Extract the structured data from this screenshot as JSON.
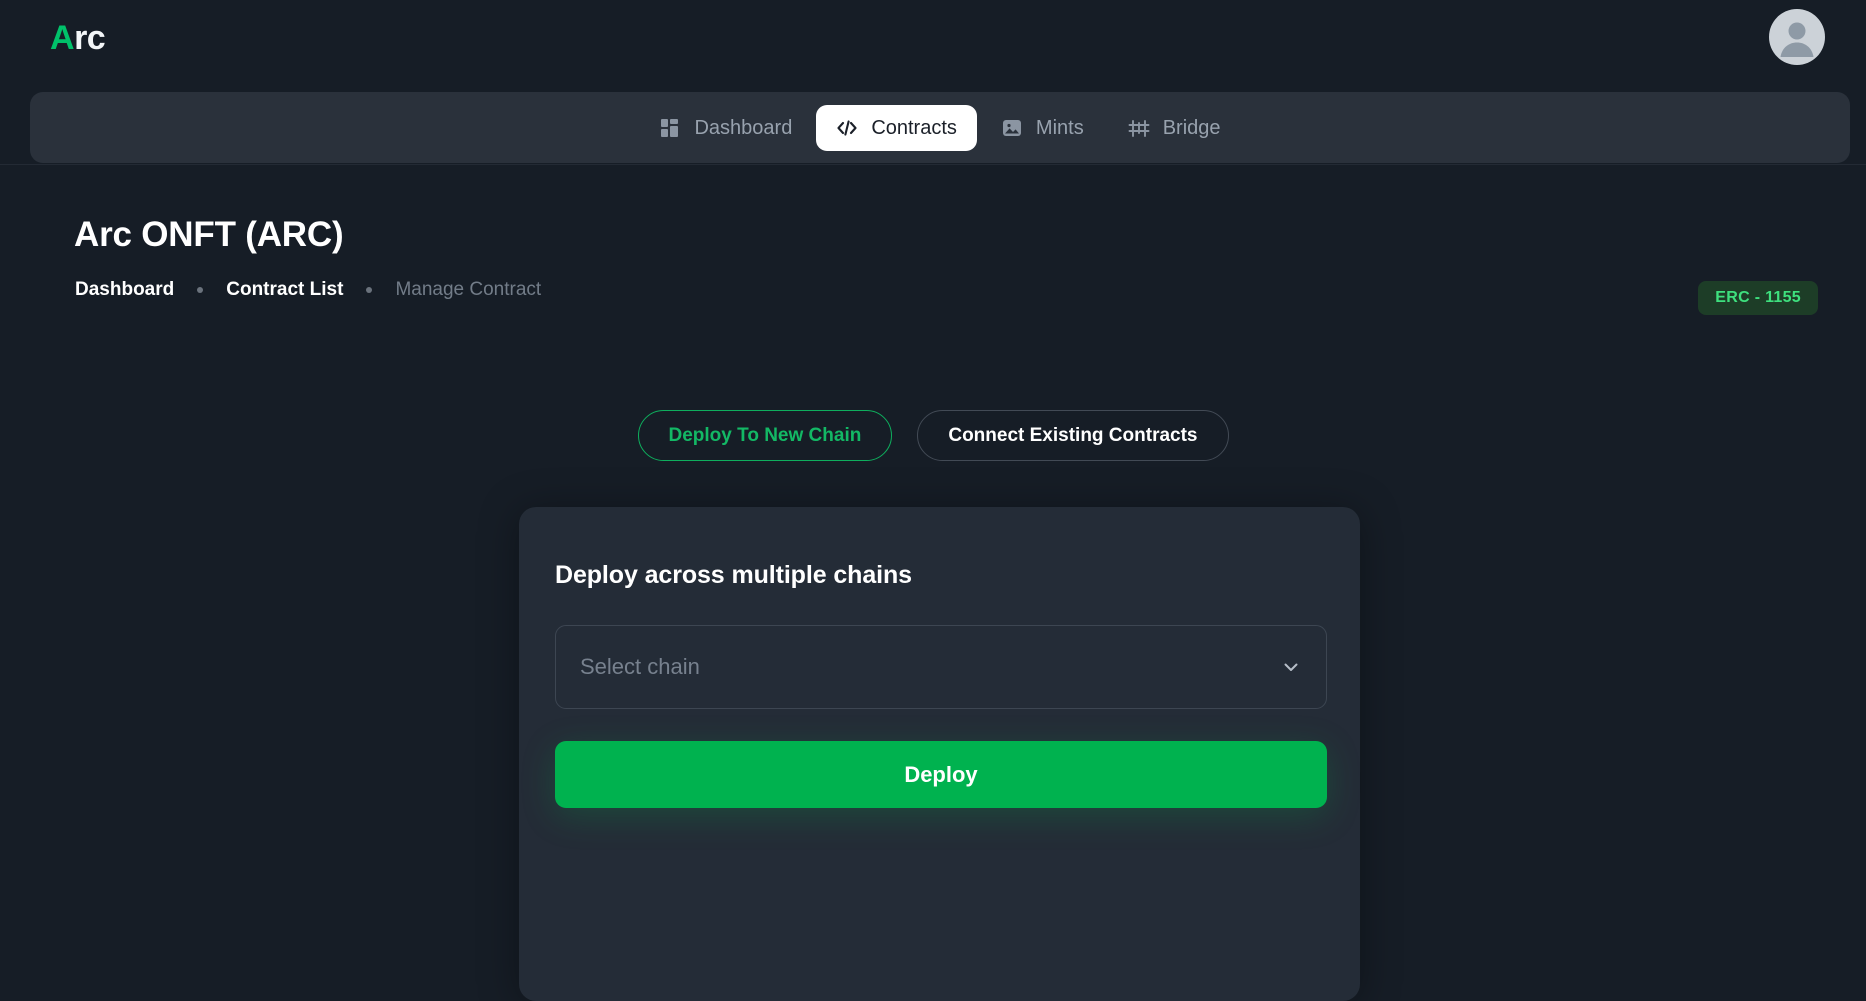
{
  "brand": {
    "accent_letter": "A",
    "rest": "rc",
    "accent_color": "#00c16a"
  },
  "account": {
    "avatar_icon": "user-avatar-icon"
  },
  "nav": {
    "items": [
      {
        "label": "Dashboard",
        "icon": "grid-dashboard-icon",
        "active": false
      },
      {
        "label": "Contracts",
        "icon": "code-brackets-icon",
        "active": true
      },
      {
        "label": "Mints",
        "icon": "image-picture-icon",
        "active": false
      },
      {
        "label": "Bridge",
        "icon": "bridge-icon",
        "active": false
      }
    ]
  },
  "header": {
    "title": "Arc ONFT (ARC)",
    "breadcrumb": [
      {
        "label": "Dashboard",
        "muted": false
      },
      {
        "label": "Contract List",
        "muted": false
      },
      {
        "label": "Manage Contract",
        "muted": true
      }
    ],
    "badge": "ERC - 1155",
    "badge_color": "#3ee07e"
  },
  "toggles": {
    "selected": "Deploy To New Chain",
    "options": [
      {
        "label": "Deploy To New Chain",
        "selected": true
      },
      {
        "label": "Connect Existing Contracts",
        "selected": false
      }
    ]
  },
  "card": {
    "title": "Deploy across multiple chains",
    "chain_select": {
      "value": "",
      "placeholder": "Select chain",
      "chevron_icon": "chevron-down-icon"
    },
    "deploy_button": "Deploy",
    "deploy_button_color": "#00b24f"
  }
}
